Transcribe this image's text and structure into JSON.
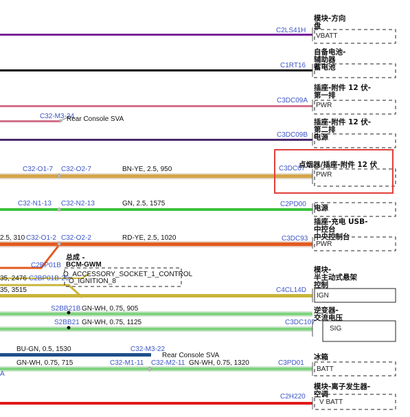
{
  "wires": [
    {
      "id": "w1",
      "color": "#7a1f9a"
    },
    {
      "id": "w2",
      "color": "#000000"
    },
    {
      "id": "w3",
      "color": "#d2708a"
    },
    {
      "id": "w4",
      "color": "#4b2a6e"
    },
    {
      "id": "w5",
      "color": "#d6a44a"
    },
    {
      "id": "w6",
      "color": "#3cc23c"
    },
    {
      "id": "w7",
      "color": "#e45a1e"
    },
    {
      "id": "w8",
      "color": "#c9b53a"
    },
    {
      "id": "w9",
      "color": "#7fd37f"
    },
    {
      "id": "w10",
      "color": "#1f4e8c"
    },
    {
      "id": "w11",
      "color": "#e21a1a"
    }
  ],
  "labels": {
    "c2ls41h": "C2LS41H",
    "c1rt16": "C1RT16",
    "c3dc09a": "C3DC09A",
    "c3dc09b": "C3DC09B",
    "c3dc07": "C3DC07",
    "c2pd00": "C2PD00",
    "c3dc93": "C3DC93",
    "c4cl14d": "C4CL14D",
    "c3dc107": "C3DC107",
    "c3pd01": "C3PD01",
    "c2h220": "C2H220",
    "c32_m3_24": "C32-M3-24",
    "rear_console_sva_1": "Rear Console SVA",
    "c32_o1_7": "C32-O1-7",
    "c32_o2_7": "C32-O2-7",
    "w5_spec": "BN-YE, 2.5, 950",
    "c32_n1_13": "C32-N1-13",
    "c32_n2_13": "C32-N2-13",
    "w6_spec": "GN, 2.5, 1575",
    "w7_prefix": "2.5, 310",
    "c32_o1_2": "C32-O1-2",
    "c32_o2_2": "C32-O2-2",
    "w7_spec": "RD-YE, 2.5, 1020",
    "c2bp01b": "C2BP01B",
    "c2bp01b_2": "C2BP01B-26",
    "bcm_gwm": "BCM-GWM",
    "zong_cheng": "总成 -",
    "accessory_socket": "O_ACCESSORY_SOCKET_1_CONTROL",
    "o_ignition": "O_IGNITION_8",
    "w8_n1": "35, 2476",
    "w8_n2": "35, 3515",
    "s2bb21b": "S2BB21B",
    "w9_spec1": "GN-WH, 0.75, 905",
    "s2bb21": "S2BB21",
    "w9_spec2": "GN-WH, 0.75, 1125",
    "w10_spec1": "BU-GN, 0.5, 1530",
    "c32_m3_22": "C32-M3-22",
    "rear_console_sva_2": "Rear Console SVA",
    "w10_spec2": "GN-WH, 0.75, 715",
    "c32_m1_11": "C32-M1-11",
    "c32_m2_11": "C32-M2-11",
    "w10_spec3": "GN-WH, 0.75, 1320",
    "w10_a": "A"
  },
  "components": {
    "c1_title": "模块-方向",
    "c1_sub": "盘",
    "c1_pin": "VBATT",
    "c2_title": "自备电池-",
    "c2_sub1": "辅助器",
    "c2_sub2": "蓄电池",
    "c3_title": "插座-附件 12 伏-",
    "c3_sub": "第一排",
    "c3_pin": "PWR",
    "c4_title": "插座-附件 12 伏-",
    "c4_sub1": "第二排",
    "c4_sub2": "电源",
    "c5_title": "点烟器/插座-附件 12 伏",
    "c5_pin": "PWR",
    "c6_title": "电源",
    "c7_title": "插座-充电 USB-",
    "c7_sub1": "中控台",
    "c7_sub2": "中央控制台",
    "c7_pin": "PWR",
    "c8_title": "模块-",
    "c8_sub1": "半主动式悬架",
    "c8_sub2": "控制",
    "c8_pin": "IGN",
    "c9_title": "逆变器-",
    "c9_sub": "交流电压",
    "c9_pin": "SIG",
    "c10_title": "冰箱",
    "c10_pin": "BATT",
    "c11_title": "模块-离子发生器-",
    "c11_sub": "空调",
    "c11_pin": "V BATT"
  },
  "highlight_color": "#e0403a"
}
